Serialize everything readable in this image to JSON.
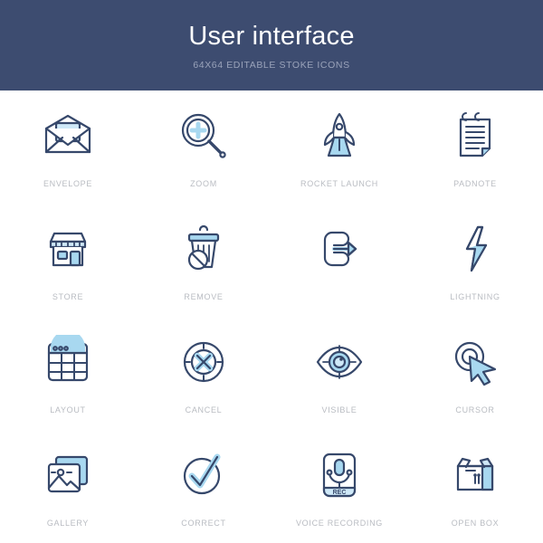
{
  "header": {
    "title": "User interface",
    "subtitle": "64X64 EDITABLE STOKE ICONS",
    "background_color": "#3d4c70",
    "title_color": "#ffffff",
    "subtitle_color": "#9aa3ba"
  },
  "palette": {
    "stroke": "#36486b",
    "fill_light_blue": "#a8d8f0",
    "fill_pale_blue": "#cfe9f8",
    "label_color": "#b9bcc2",
    "page_background": "#ffffff"
  },
  "grid": {
    "columns": 4,
    "rows": 4,
    "icons": [
      {
        "label": "envelope",
        "icon": "envelope-icon"
      },
      {
        "label": "zoom",
        "icon": "magnifier-plus-icon"
      },
      {
        "label": "rocket launch",
        "icon": "rocket-icon"
      },
      {
        "label": "padnote",
        "icon": "notepad-icon"
      },
      {
        "label": "store",
        "icon": "storefront-icon"
      },
      {
        "label": "remove",
        "icon": "trash-prohibited-icon"
      },
      {
        "label": "",
        "icon": "logout-arrow-icon"
      },
      {
        "label": "lightning",
        "icon": "lightning-bolt-icon"
      },
      {
        "label": "layout",
        "icon": "window-grid-icon"
      },
      {
        "label": "cancel",
        "icon": "circle-x-icon"
      },
      {
        "label": "visible",
        "icon": "eye-icon"
      },
      {
        "label": "cursor",
        "icon": "cursor-pointer-icon"
      },
      {
        "label": "gallery",
        "icon": "photo-stack-icon"
      },
      {
        "label": "correct",
        "icon": "circle-check-icon"
      },
      {
        "label": "voice recording",
        "icon": "microphone-rec-icon"
      },
      {
        "label": "open box",
        "icon": "open-box-icon"
      }
    ]
  }
}
